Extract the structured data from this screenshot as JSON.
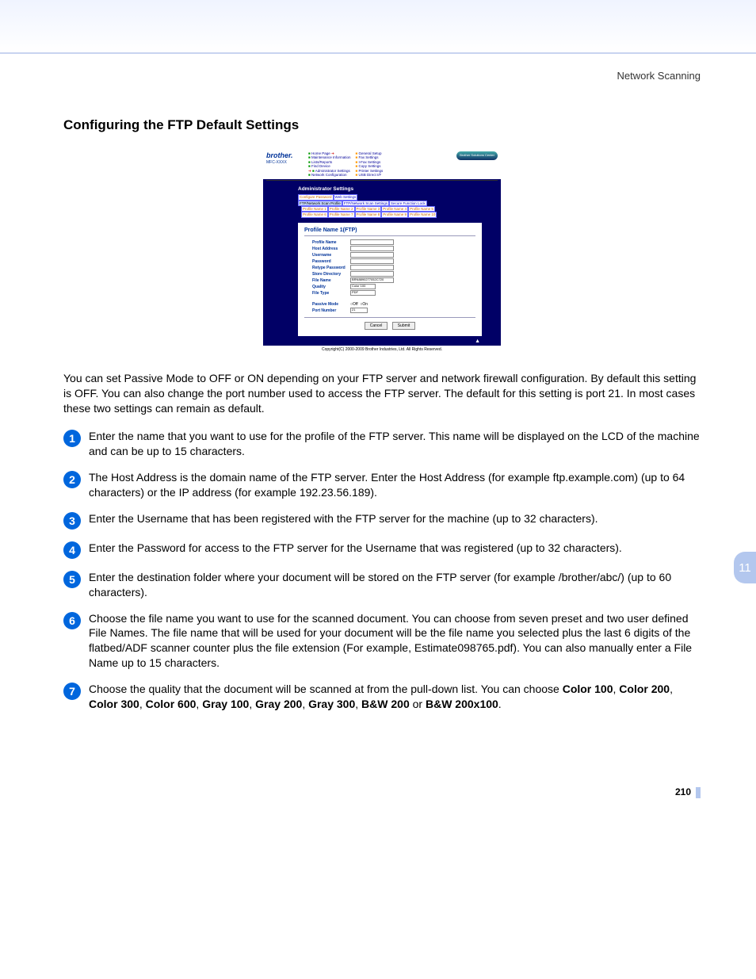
{
  "header": {
    "section": "Network Scanning"
  },
  "title": "Configuring the FTP Default Settings",
  "screenshot": {
    "logo": "brother.",
    "model": "MFC-XXXX",
    "nav_col1": [
      "Home Page",
      "Maintenance Information",
      "Lists/Reports",
      "Find Device",
      "Administrator Settings",
      "Network Configuration"
    ],
    "nav_col2": [
      "General Setup",
      "Fax Settings",
      "I-Fax Settings",
      "Copy Settings",
      "Printer Settings",
      "USB Direct I/F"
    ],
    "solutions": "Brother Solutions Center",
    "admin_title": "Administrator Settings",
    "tab_row1": [
      "Configure Password",
      "Web Settings"
    ],
    "tab_row2": [
      "FTP/Network Scan Profile",
      "FTP/Network Scan Settings",
      "Secure Function Lock"
    ],
    "tab_row3": [
      "Profile Name 1",
      "Profile Name 2",
      "Profile Name 3",
      "Profile Name 4",
      "Profile Name 5"
    ],
    "tab_row4": [
      "Profile Name 6",
      "Profile Name 7",
      "Profile Name 8",
      "Profile Name 9",
      "Profile Name 10"
    ],
    "panel_title": "Profile Name 1(FTP)",
    "fields": {
      "profile_name": "Profile Name",
      "host_address": "Host Address",
      "username": "Username",
      "password": "Password",
      "retype_password": "Retype Password",
      "store_directory": "Store Directory",
      "file_name": "File Name",
      "file_name_val": "BRN8890277052C720",
      "quality": "Quality",
      "quality_val": "Color 100",
      "file_type": "File Type",
      "file_type_val": "PDF",
      "passive_mode": "Passive Mode",
      "passive_off": "Off",
      "passive_on": "On",
      "port_number": "Port Number",
      "port_val": "21"
    },
    "buttons": {
      "cancel": "Cancel",
      "submit": "Submit"
    },
    "copyright": "Copyright(C) 2000-2009 Brother Industries, Ltd. All Rights Reserved."
  },
  "intro": "You can set Passive Mode to OFF or ON depending on your FTP server and network firewall configuration. By default this setting is OFF. You can also change the port number used to access the FTP server. The default for this setting is port 21. In most cases these two settings can remain as default.",
  "steps": [
    {
      "n": "1",
      "t": "Enter the name that you want to use for the profile of the FTP server. This name will be displayed on the LCD of the machine and can be up to 15 characters."
    },
    {
      "n": "2",
      "t": "The Host Address is the domain name of the FTP server. Enter the Host Address (for example ftp.example.com) (up to 64 characters) or the IP address (for example 192.23.56.189)."
    },
    {
      "n": "3",
      "t": "Enter the Username that has been registered with the FTP server for the machine (up to 32 characters)."
    },
    {
      "n": "4",
      "t": "Enter the Password for access to the FTP server for the Username that was registered (up to 32 characters)."
    },
    {
      "n": "5",
      "t": "Enter the destination folder where your document will be stored on the FTP server (for example /brother/abc/) (up to 60 characters)."
    },
    {
      "n": "6",
      "t": "Choose the file name you want to use for the scanned document. You can choose from seven preset and two user defined File Names. The file name that will be used for your document will be the file name you selected plus the last 6 digits of the flatbed/ADF scanner counter plus the file extension (For example, Estimate098765.pdf). You can also manually enter a File Name up to 15 characters."
    }
  ],
  "step7": {
    "n": "7",
    "lead": "Choose the quality that the document will be scanned at from the pull-down list. You can choose ",
    "opts": [
      "Color 100",
      "Color 200",
      "Color 300",
      "Color 600",
      "Gray 100",
      "Gray 200",
      "Gray 300",
      "B&W 200"
    ],
    "or": " or ",
    "last": "B&W 200x100",
    "end": "."
  },
  "side_tab": "11",
  "page_number": "210"
}
